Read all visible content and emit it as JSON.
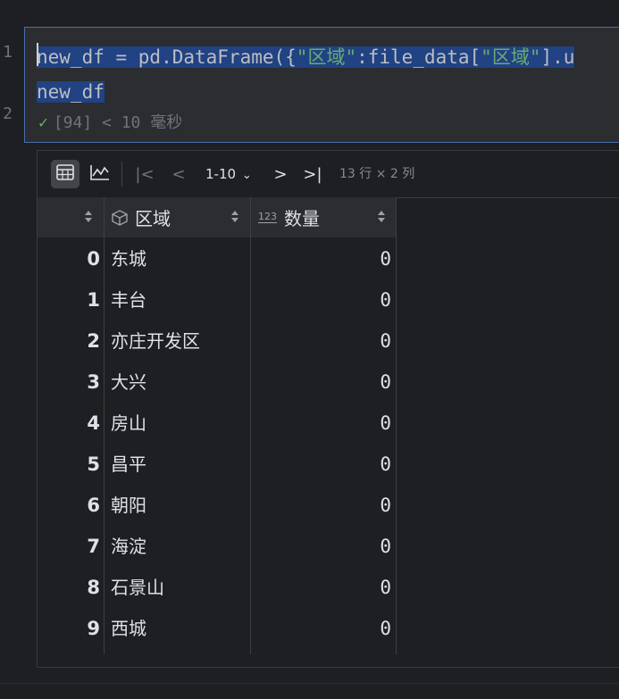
{
  "editor": {
    "line_numbers": [
      "1",
      "2"
    ],
    "line1": {
      "p1": "new_df = pd.DataFrame({",
      "s1": "\"区域\"",
      "p2": ":file_data[",
      "s2": "\"区域\"",
      "p3": "].u"
    },
    "line2": "new_df",
    "status": "[94] < 10 毫秒"
  },
  "toolbar": {
    "table_icon": "table-icon",
    "chart_icon": "chart-icon",
    "first_page": "|<",
    "prev_page": "<",
    "page_range": "1-10",
    "next_page": ">",
    "last_page": ">|",
    "info": "13 行 × 2 列"
  },
  "table": {
    "columns": [
      {
        "name": "区域",
        "type_icon": "cube-icon"
      },
      {
        "name": "数量",
        "type_icon": "123-icon"
      }
    ],
    "rows": [
      {
        "index": "0",
        "region": "东城",
        "count": "0"
      },
      {
        "index": "1",
        "region": "丰台",
        "count": "0"
      },
      {
        "index": "2",
        "region": "亦庄开发区",
        "count": "0"
      },
      {
        "index": "3",
        "region": "大兴",
        "count": "0"
      },
      {
        "index": "4",
        "region": "房山",
        "count": "0"
      },
      {
        "index": "5",
        "region": "昌平",
        "count": "0"
      },
      {
        "index": "6",
        "region": "朝阳",
        "count": "0"
      },
      {
        "index": "7",
        "region": "海淀",
        "count": "0"
      },
      {
        "index": "8",
        "region": "石景山",
        "count": "0"
      },
      {
        "index": "9",
        "region": "西城",
        "count": "0"
      }
    ]
  }
}
